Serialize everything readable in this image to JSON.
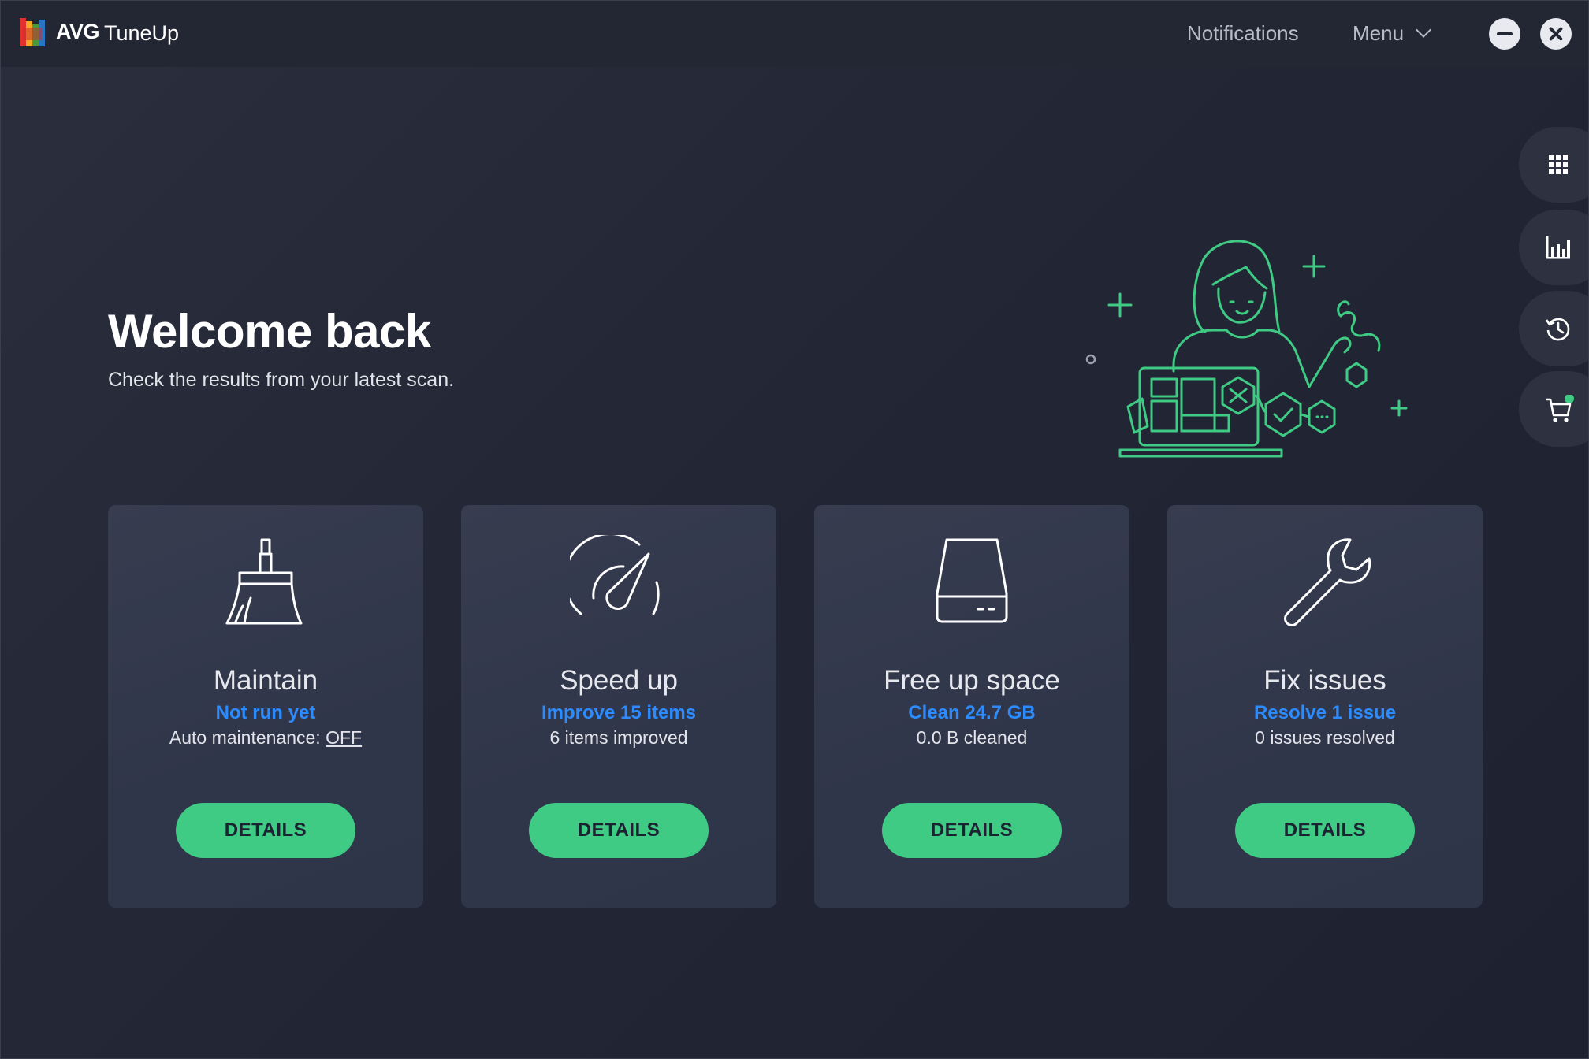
{
  "app": {
    "brand": "AVG",
    "product": "TuneUp"
  },
  "header": {
    "notifications_label": "Notifications",
    "menu_label": "Menu"
  },
  "hero": {
    "title": "Welcome back",
    "subtitle": "Check the results from your latest scan."
  },
  "side_rail": [
    {
      "icon": "apps-grid-icon"
    },
    {
      "icon": "bar-chart-icon"
    },
    {
      "icon": "history-icon"
    },
    {
      "icon": "cart-icon",
      "badge_color": "#3fcb84"
    }
  ],
  "cards": [
    {
      "icon": "broom-icon",
      "title": "Maintain",
      "action": "Not run yet",
      "status_prefix": "Auto maintenance: ",
      "status_toggle": "OFF",
      "button": "DETAILS"
    },
    {
      "icon": "speedometer-icon",
      "title": "Speed up",
      "action": "Improve 15 items",
      "status": "6 items improved",
      "button": "DETAILS"
    },
    {
      "icon": "hard-drive-icon",
      "title": "Free up space",
      "action": "Clean 24.7 GB",
      "status": "0.0 B cleaned",
      "button": "DETAILS"
    },
    {
      "icon": "wrench-icon",
      "title": "Fix issues",
      "action": "Resolve 1 issue",
      "status": "0 issues resolved",
      "button": "DETAILS"
    }
  ],
  "colors": {
    "accent_green": "#3fcb84",
    "link_blue": "#2c8cff",
    "background": "#1f2330",
    "card": "#353a4d"
  }
}
